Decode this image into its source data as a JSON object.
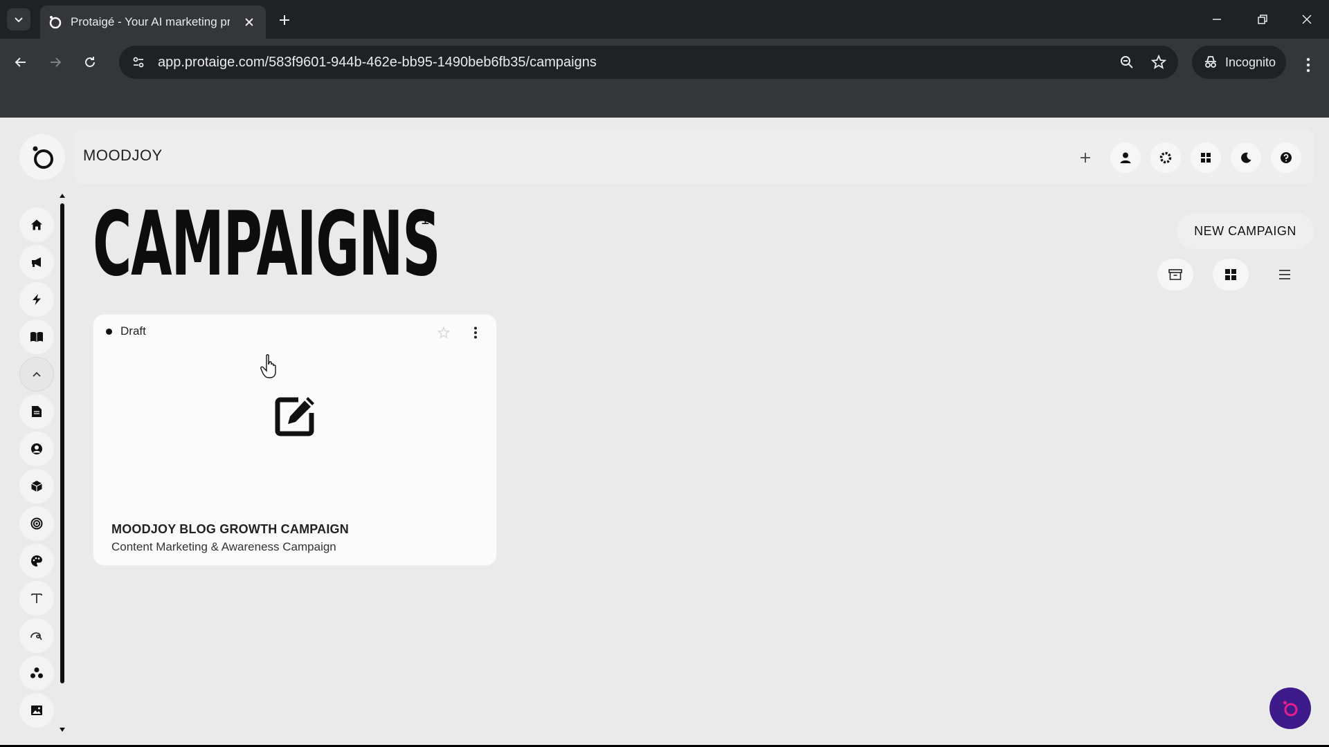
{
  "browser": {
    "tab_title": "Protaigé - Your AI marketing pr",
    "url": "app.protaige.com/583f9601-944b-462e-bb95-1490beb6fb35/campaigns",
    "profile_label": "Incognito"
  },
  "app": {
    "workspace": "MOODJOY",
    "page_title": "CAMPAIGNS",
    "campaign_count": "1",
    "new_campaign_label": "NEW CAMPAIGN",
    "accent_color": "#3d1b8a"
  },
  "campaigns": [
    {
      "status": "Draft",
      "title": "MOODJOY BLOG GROWTH CAMPAIGN",
      "subtitle": "Content Marketing & Awareness Campaign"
    }
  ],
  "sidebar_icons": [
    "home-icon",
    "megaphone-icon",
    "bolt-icon",
    "book-icon",
    "chevron-up-icon",
    "document-icon",
    "user-circle-icon",
    "cube-icon",
    "target-icon",
    "palette-icon",
    "text-icon",
    "swirl-icon",
    "group-icon",
    "image-icon"
  ],
  "header_icons": [
    "plus-icon",
    "user-icon",
    "gear-icon",
    "grid-icon",
    "moon-icon",
    "help-icon"
  ]
}
